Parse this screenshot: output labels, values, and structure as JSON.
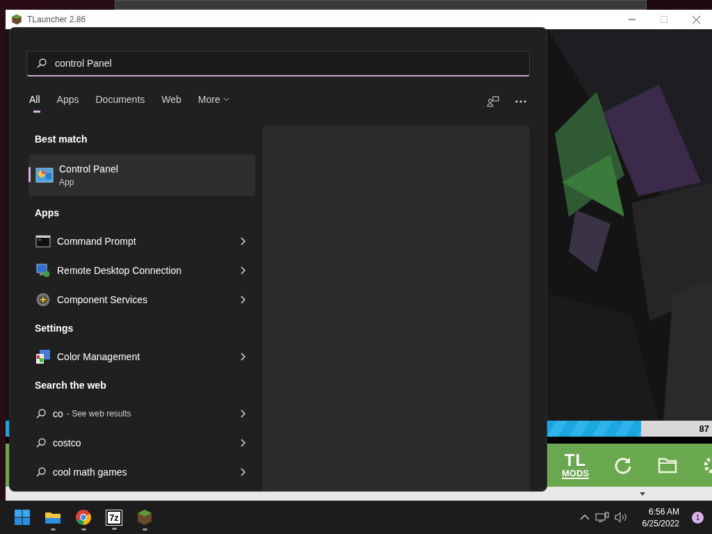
{
  "launcher": {
    "title": "TLauncher 2.86",
    "progress": {
      "level": 0.9,
      "reading": "87"
    },
    "logo": {
      "top": "TL",
      "bottom": "MODS"
    }
  },
  "start_menu": {
    "search": {
      "value": "control Panel"
    },
    "tabs": [
      {
        "label": "All",
        "selected": true
      },
      {
        "label": "Apps",
        "selected": false
      },
      {
        "label": "Documents",
        "selected": false
      },
      {
        "label": "Web",
        "selected": false
      },
      {
        "label": "More",
        "selected": false,
        "dropdown": true
      }
    ],
    "best_match": {
      "heading": "Best match",
      "title": "Control Panel",
      "subtitle": "App",
      "selected": true
    },
    "sections": [
      {
        "heading": "Apps",
        "items": [
          {
            "kind": "terminal",
            "label": "Command Prompt"
          },
          {
            "kind": "remote",
            "label": "Remote Desktop Connection"
          },
          {
            "kind": "services",
            "label": "Component Services"
          }
        ]
      },
      {
        "heading": "Settings",
        "items": [
          {
            "kind": "color",
            "label": "Color Management"
          }
        ]
      },
      {
        "heading": "Search the web",
        "items": [
          {
            "kind": "web",
            "label": "co",
            "hint": "- See web results"
          },
          {
            "kind": "web",
            "label": "costco"
          },
          {
            "kind": "web",
            "label": "cool math games"
          }
        ]
      }
    ]
  },
  "taskbar": {
    "apps": [
      {
        "kind": "start",
        "running": false
      },
      {
        "kind": "explorer",
        "running": true
      },
      {
        "kind": "browser",
        "running": true
      },
      {
        "kind": "archiver",
        "running": true,
        "text": "7z"
      },
      {
        "kind": "game",
        "running": true
      }
    ],
    "time": "6:56 AM",
    "date": "6/25/2022",
    "notifications": "1"
  }
}
